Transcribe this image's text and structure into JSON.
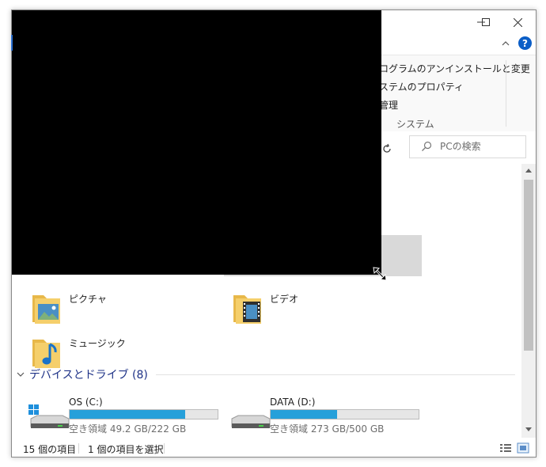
{
  "window": {
    "controls": {
      "minimize": "minimize",
      "maximize": "maximize",
      "close": "close"
    }
  },
  "ribbon": {
    "items": [
      "ログラムのアンインストールと変更",
      "ステムのプロパティ",
      "管理"
    ],
    "group_label": "システム",
    "help": "?"
  },
  "search": {
    "placeholder": "PCの検索"
  },
  "folders": [
    {
      "name": "ピクチャ",
      "icon": "pictures-folder-icon"
    },
    {
      "name": "ビデオ",
      "icon": "videos-folder-icon"
    },
    {
      "name": "ミュージック",
      "icon": "music-folder-icon"
    }
  ],
  "devices": {
    "title": "デバイスとドライブ (8)",
    "drives": [
      {
        "name": "OS (C:)",
        "space": "空き領域 49.2 GB/222 GB",
        "used_fraction": 0.78
      },
      {
        "name": "DATA (D:)",
        "space": "空き領域 273 GB/500 GB",
        "used_fraction": 0.45
      }
    ]
  },
  "status": {
    "count": "15 個の項目",
    "selected": "1 個の項目を選択"
  },
  "colors": {
    "accent": "#26a0da",
    "section_title": "#1e3287"
  }
}
